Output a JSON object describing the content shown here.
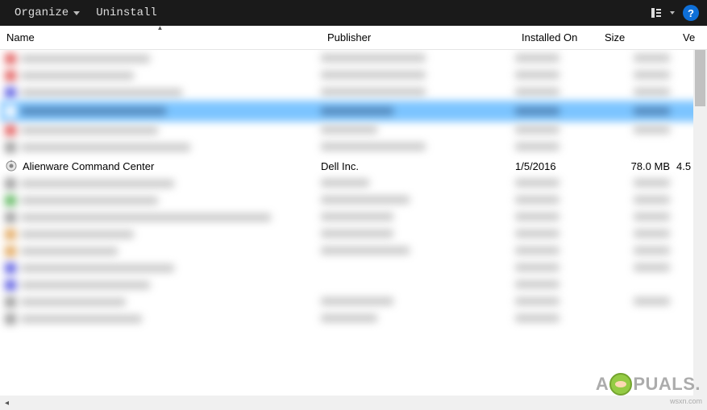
{
  "toolbar": {
    "organize_label": "Organize",
    "uninstall_label": "Uninstall",
    "help_symbol": "?"
  },
  "columns": {
    "name": "Name",
    "publisher": "Publisher",
    "installed_on": "Installed On",
    "size": "Size",
    "version": "Ve"
  },
  "visible_program": {
    "name": "Alienware Command Center",
    "publisher": "Dell Inc.",
    "installed_on": "1/5/2016",
    "size": "78.0 MB",
    "version": "4.5"
  },
  "watermark": {
    "prefix": "A",
    "suffix": "PUALS.",
    "site": "wsxn.com"
  },
  "colors": {
    "toolbar_bg": "#1a1a1a",
    "selection": "#5cb6ff",
    "help_bg": "#0e6fd8"
  }
}
